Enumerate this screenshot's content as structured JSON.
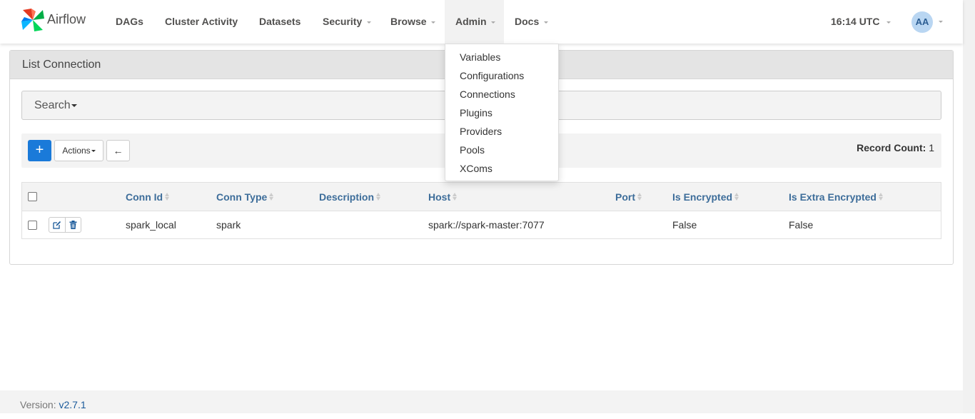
{
  "navbar": {
    "brand": "Airflow",
    "items": [
      {
        "label": "DAGs"
      },
      {
        "label": "Cluster Activity"
      },
      {
        "label": "Datasets"
      },
      {
        "label": "Security"
      },
      {
        "label": "Browse"
      },
      {
        "label": "Admin"
      },
      {
        "label": "Docs"
      }
    ],
    "clock": "16:14 UTC",
    "avatar": "AA"
  },
  "admin_menu": {
    "items": [
      "Variables",
      "Configurations",
      "Connections",
      "Plugins",
      "Providers",
      "Pools",
      "XComs"
    ]
  },
  "panel": {
    "title": "List Connection",
    "search_label": "Search",
    "actions_label": "Actions",
    "add_label": "+",
    "back_label": "←",
    "record_count_label": "Record Count:",
    "record_count": "1"
  },
  "table": {
    "columns": [
      "Conn Id",
      "Conn Type",
      "Description",
      "Host",
      "Port",
      "Is Encrypted",
      "Is Extra Encrypted"
    ],
    "rows": [
      {
        "conn_id": "spark_local",
        "conn_type": "spark",
        "description": "",
        "host": "spark://spark-master:7077",
        "port": "",
        "is_encrypted": "False",
        "is_extra_encrypted": "False"
      }
    ]
  },
  "footer": {
    "version_label": "Version:",
    "version": "v2.7.1"
  },
  "colors": {
    "primary": "#1a7ad9",
    "header_link": "#3d6d9a",
    "avatar_bg": "#b9d6f2"
  }
}
